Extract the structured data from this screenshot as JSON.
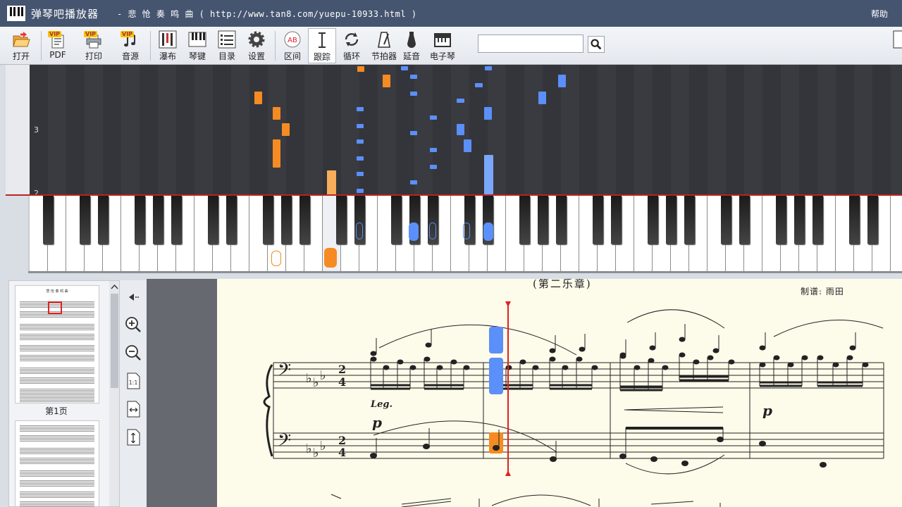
{
  "app": {
    "name": "弹琴吧播放器",
    "song_title": "- 悲 怆 奏 鸣 曲 ( http://www.tan8.com/yuepu-10933.html )",
    "help": "帮助"
  },
  "toolbar": {
    "open": "打开",
    "pdf": "PDF",
    "print": "打印",
    "sound": "音源",
    "waterfall": "瀑布",
    "keys": "琴键",
    "contents": "目录",
    "settings": "设置",
    "range": "区间",
    "follow": "跟踪",
    "loop": "循环",
    "metronome": "节拍器",
    "sustain": "延音",
    "e_piano": "电子琴",
    "vip_badge": "VIP",
    "search_placeholder": ""
  },
  "waterfall": {
    "measure_labels": [
      "3",
      "2"
    ]
  },
  "thumbnails": {
    "page1_caption": "第1页",
    "page1_title": "悲 怆 奏 鸣 曲"
  },
  "score": {
    "movement": "(第二乐章)",
    "arranger": "制谱: 雨田",
    "dynamic_p1": "p",
    "dynamic_p2": "p",
    "legato": "Leg.",
    "time_sig_top": "2",
    "time_sig_bottom": "4"
  },
  "colors": {
    "titlebar": "#45556f",
    "left_hand": "#f58b22",
    "right_hand": "#5b8ff9",
    "cursor": "#e02020"
  }
}
